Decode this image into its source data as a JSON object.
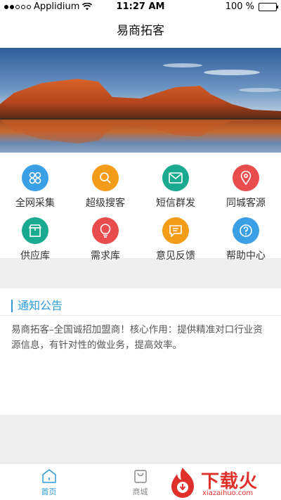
{
  "status_bar": {
    "carrier": "Applidium",
    "time": "11:27 AM",
    "battery": "100 %"
  },
  "nav": {
    "title": "易商拓客"
  },
  "grid": {
    "items": [
      {
        "label": "全网采集",
        "icon": "clover-icon",
        "color": "#3b9fe6"
      },
      {
        "label": "超级搜客",
        "icon": "search-icon",
        "color": "#f39c1a"
      },
      {
        "label": "短信群发",
        "icon": "mail-icon",
        "color": "#1aaa8f"
      },
      {
        "label": "同城客源",
        "icon": "location-pin-icon",
        "color": "#e84c4c"
      },
      {
        "label": "供应库",
        "icon": "store-icon",
        "color": "#1aaa8f"
      },
      {
        "label": "需求库",
        "icon": "lightbulb-icon",
        "color": "#e84c4c"
      },
      {
        "label": "意见反馈",
        "icon": "chat-icon",
        "color": "#f39c1a"
      },
      {
        "label": "帮助中心",
        "icon": "help-icon",
        "color": "#3b9fe6"
      }
    ]
  },
  "notice": {
    "title": "通知公告",
    "text": "易商拓客–全国诚招加盟商！核心作用：提供精准对口行业资源信息，有针对性的做业务，提高效率。"
  },
  "tabs": [
    {
      "label": "首页",
      "icon": "home-icon",
      "active": true
    },
    {
      "label": "商城",
      "icon": "shopping-bag-icon",
      "active": false
    }
  ],
  "watermark": {
    "brand": "下载火",
    "url": "xiazaihuo.com"
  },
  "colors": {
    "accent": "#2d9bd9",
    "watermark": "#e0302c"
  }
}
